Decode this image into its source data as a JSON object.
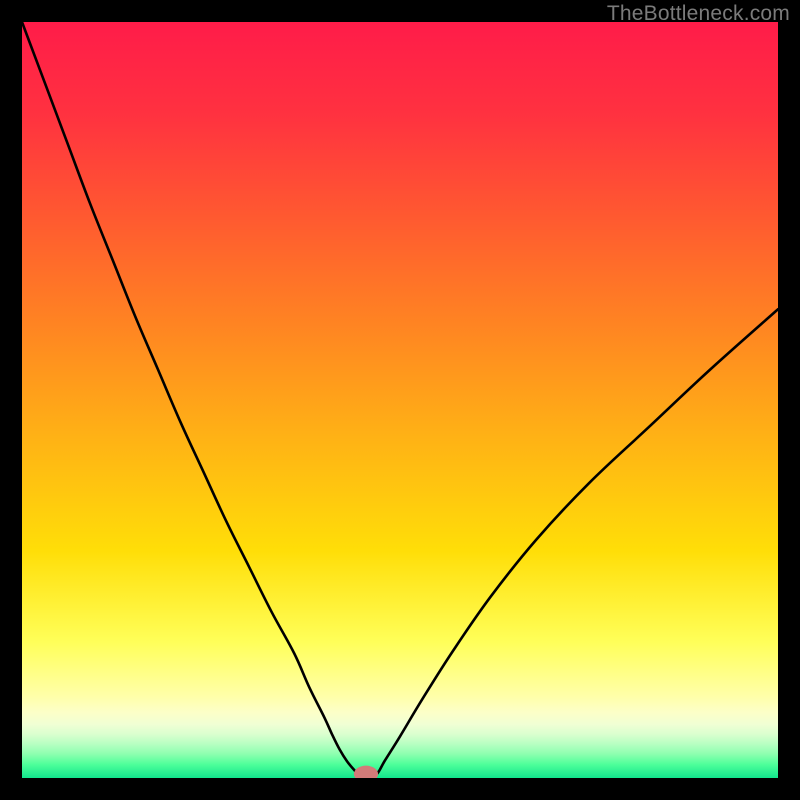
{
  "attribution": "TheBottleneck.com",
  "colors": {
    "frame": "#000000",
    "curve_stroke": "#000000",
    "marker_fill": "#d27b79",
    "gradient_stops": [
      {
        "pos": 0.0,
        "color": "#ff1c49"
      },
      {
        "pos": 0.12,
        "color": "#ff3140"
      },
      {
        "pos": 0.25,
        "color": "#ff5731"
      },
      {
        "pos": 0.4,
        "color": "#ff8422"
      },
      {
        "pos": 0.55,
        "color": "#ffb215"
      },
      {
        "pos": 0.7,
        "color": "#ffde08"
      },
      {
        "pos": 0.82,
        "color": "#ffff59"
      },
      {
        "pos": 0.892,
        "color": "#ffffa9"
      },
      {
        "pos": 0.913,
        "color": "#fcffc8"
      },
      {
        "pos": 0.929,
        "color": "#f0ffd4"
      },
      {
        "pos": 0.942,
        "color": "#daffcf"
      },
      {
        "pos": 0.955,
        "color": "#b7ffc2"
      },
      {
        "pos": 0.968,
        "color": "#8effb0"
      },
      {
        "pos": 0.982,
        "color": "#4eff9a"
      },
      {
        "pos": 1.0,
        "color": "#12e58d"
      }
    ]
  },
  "chart_data": {
    "type": "line",
    "title": "",
    "xlabel": "",
    "ylabel": "",
    "xlim": [
      0,
      100
    ],
    "ylim": [
      0,
      100
    ],
    "x": [
      0,
      3,
      6,
      9,
      12,
      15,
      18,
      21,
      24,
      27,
      30,
      33,
      36,
      38,
      40,
      41,
      42,
      43,
      44,
      45,
      46,
      47,
      48,
      50,
      53,
      57,
      62,
      68,
      75,
      83,
      91,
      100
    ],
    "values": [
      100,
      92,
      84,
      76,
      68.5,
      61,
      54,
      47,
      40.5,
      34,
      28,
      22,
      16.5,
      12,
      8,
      5.8,
      3.8,
      2.2,
      1.0,
      0.0,
      0.0,
      0.6,
      2.3,
      5.5,
      10.5,
      16.8,
      24,
      31.5,
      39,
      46.5,
      54,
      62
    ],
    "marker": {
      "x_center": 45.5,
      "y_center": 0.0,
      "rx": 1.6,
      "ry": 1.1
    },
    "note": "Values are approximate readings of curve height as percent of inner plot height (0 at bottom edge)."
  }
}
